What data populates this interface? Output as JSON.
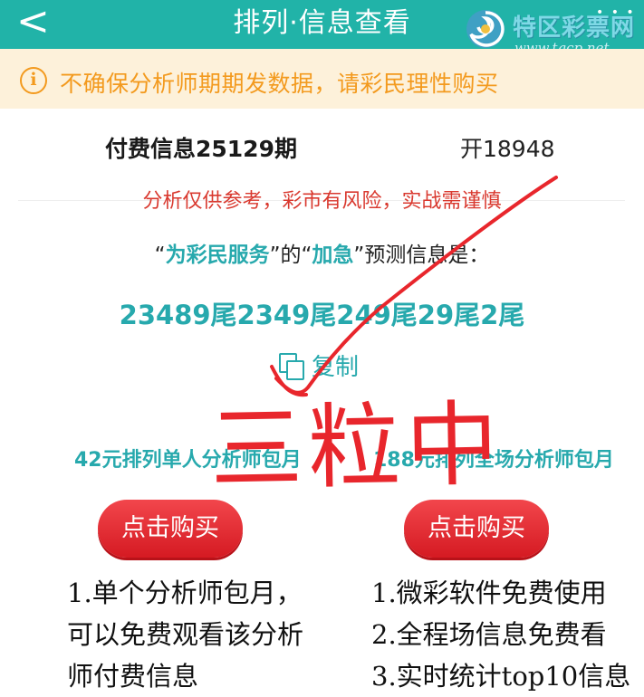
{
  "header": {
    "back_icon": "chevron-left-icon",
    "back_glyph": "<",
    "title": "排列·信息查看"
  },
  "logo": {
    "name": "特区彩票网",
    "url": "www.tqcp.net",
    "dots": "• • •",
    "colors": {
      "swirl": "#4aa3c8",
      "swirl_inner": "#f0c040"
    }
  },
  "notice": {
    "icon": "info-icon",
    "icon_glyph": "i",
    "text": "不确保分析师期期发数据，请彩民理性购买"
  },
  "info": {
    "paid_title": "付费信息25129期",
    "open_number": "开18948",
    "disclaimer": "分析仅供参考，彩市有风险，实战需谨慎",
    "predict_q1": "“",
    "predict_service": "为彩民服务",
    "predict_q2": "”的“",
    "predict_urgent": "加急",
    "predict_q3": "”预测信息是：",
    "predict_value": "23489尾2349尾249尾29尾2尾",
    "copy_label": "复制"
  },
  "stamp": {
    "text": "三粒中",
    "color": "#e8262c"
  },
  "plans": [
    {
      "title": "42元排列单人分析师包月",
      "button": "点击购买",
      "features": [
        "1.单个分析师包月，",
        "可以免费观看该分析",
        "师付费信息"
      ]
    },
    {
      "title": "188元排列全场分析师包月",
      "button": "点击购买",
      "features": [
        "1.微彩软件免费使用",
        "2.全程场信息免费看",
        "3.实时统计top10信息"
      ]
    }
  ],
  "colors": {
    "header": "#21b3a8",
    "accent_teal": "#27a9ad",
    "warning_orange": "#f39a1e",
    "notice_bg": "#fdf1da",
    "disclaimer_red": "#d9392f",
    "button_red": "#e0252c"
  }
}
